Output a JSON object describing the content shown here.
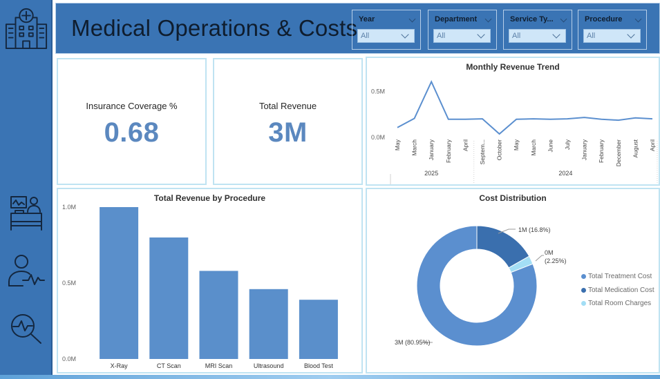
{
  "header": {
    "title": "Medical Operations & Costs"
  },
  "sidebar": {
    "icons": [
      "hospital-icon",
      "patient-bed-icon",
      "doctor-pulse-icon",
      "search-health-icon"
    ]
  },
  "filters": [
    {
      "label": "Year",
      "value": "All"
    },
    {
      "label": "Department",
      "value": "All"
    },
    {
      "label": "Service Ty...",
      "value": "All"
    },
    {
      "label": "Procedure",
      "value": "All"
    }
  ],
  "kpis": {
    "insurance": {
      "label": "Insurance Coverage %",
      "value": "0.68"
    },
    "revenue": {
      "label": "Total Revenue",
      "value": "3M"
    }
  },
  "colors": {
    "accent": "#3a74b4",
    "bar": "#5a8fcb",
    "donut_main": "#5b8fcf",
    "donut_medication": "#3a6fae",
    "donut_room": "#a3def5"
  },
  "chart_data": [
    {
      "type": "line",
      "title": "Monthly Revenue Trend",
      "categories": [
        "May",
        "March",
        "January",
        "February",
        "April",
        "Septem...",
        "October",
        "May",
        "March",
        "June",
        "July",
        "January",
        "February",
        "December",
        "August",
        "April"
      ],
      "groups": [
        {
          "label": "2025",
          "from": 0,
          "to": 5
        },
        {
          "label": "2024",
          "from": 5,
          "to": 16
        }
      ],
      "values": [
        0.1,
        0.2,
        0.6,
        0.19,
        0.19,
        0.195,
        0.03,
        0.19,
        0.195,
        0.19,
        0.195,
        0.21,
        0.19,
        0.18,
        0.205,
        0.195
      ],
      "yticks": [
        "0.0M",
        "0.5M"
      ],
      "ylim": [
        0,
        0.6
      ]
    },
    {
      "type": "bar",
      "title": "Total Revenue by Procedure",
      "categories": [
        "X-Ray",
        "CT Scan",
        "MRI Scan",
        "Ultrasound",
        "Blood Test"
      ],
      "values": [
        1.0,
        0.8,
        0.58,
        0.46,
        0.39
      ],
      "yticks": [
        "0.0M",
        "0.5M",
        "1.0M"
      ],
      "ylim": [
        0,
        1.0
      ]
    },
    {
      "type": "pie",
      "title": "Cost Distribution",
      "slices": [
        {
          "name": "Total Treatment Cost",
          "value": 80.95,
          "label": "3M (80.95%)"
        },
        {
          "name": "Total Medication Cost",
          "value": 16.8,
          "label": "1M (16.8%)"
        },
        {
          "name": "Total Room Charges",
          "value": 2.25,
          "label_line1": "0M",
          "label_line2": "(2.25%)"
        }
      ]
    }
  ]
}
